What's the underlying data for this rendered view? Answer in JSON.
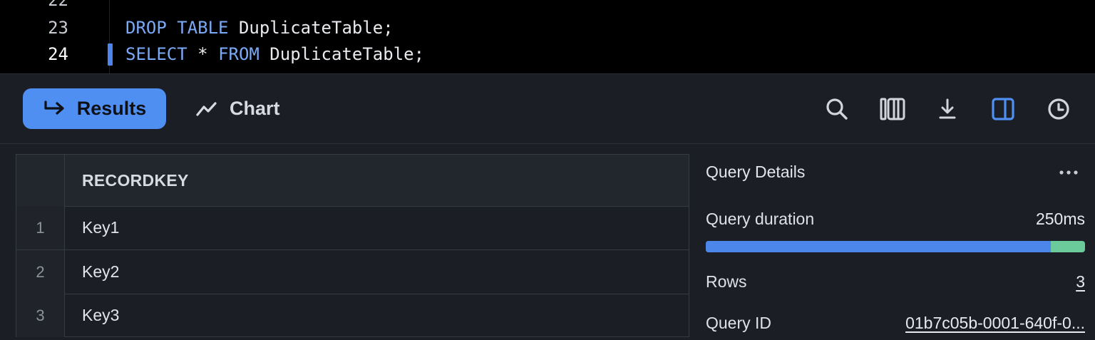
{
  "editor": {
    "lines": [
      {
        "number": "22",
        "code": ""
      },
      {
        "number": "23",
        "keyword": "DROP TABLE",
        "rest": " DuplicateTable;"
      },
      {
        "number": "24",
        "keyword": "SELECT",
        "star": " * ",
        "keyword2": "FROM",
        "rest": " DuplicateTable;"
      }
    ]
  },
  "toolbar": {
    "tabs": {
      "results_label": "Results",
      "chart_label": "Chart"
    },
    "icons": [
      "search-icon",
      "columns-icon",
      "download-icon",
      "panel-toggle-icon",
      "history-icon"
    ],
    "accent_color": "#4f8ff1"
  },
  "grid": {
    "column_header": "RECORDKEY",
    "rows": [
      {
        "num": "1",
        "value": "Key1"
      },
      {
        "num": "2",
        "value": "Key2"
      },
      {
        "num": "3",
        "value": "Key3"
      }
    ]
  },
  "details": {
    "title": "Query Details",
    "duration_label": "Query duration",
    "duration_value": "250ms",
    "duration_progress": 0.91,
    "rows_label": "Rows",
    "rows_value": "3",
    "query_id_label": "Query ID",
    "query_id_value": "01b7c05b-0001-640f-0..."
  }
}
